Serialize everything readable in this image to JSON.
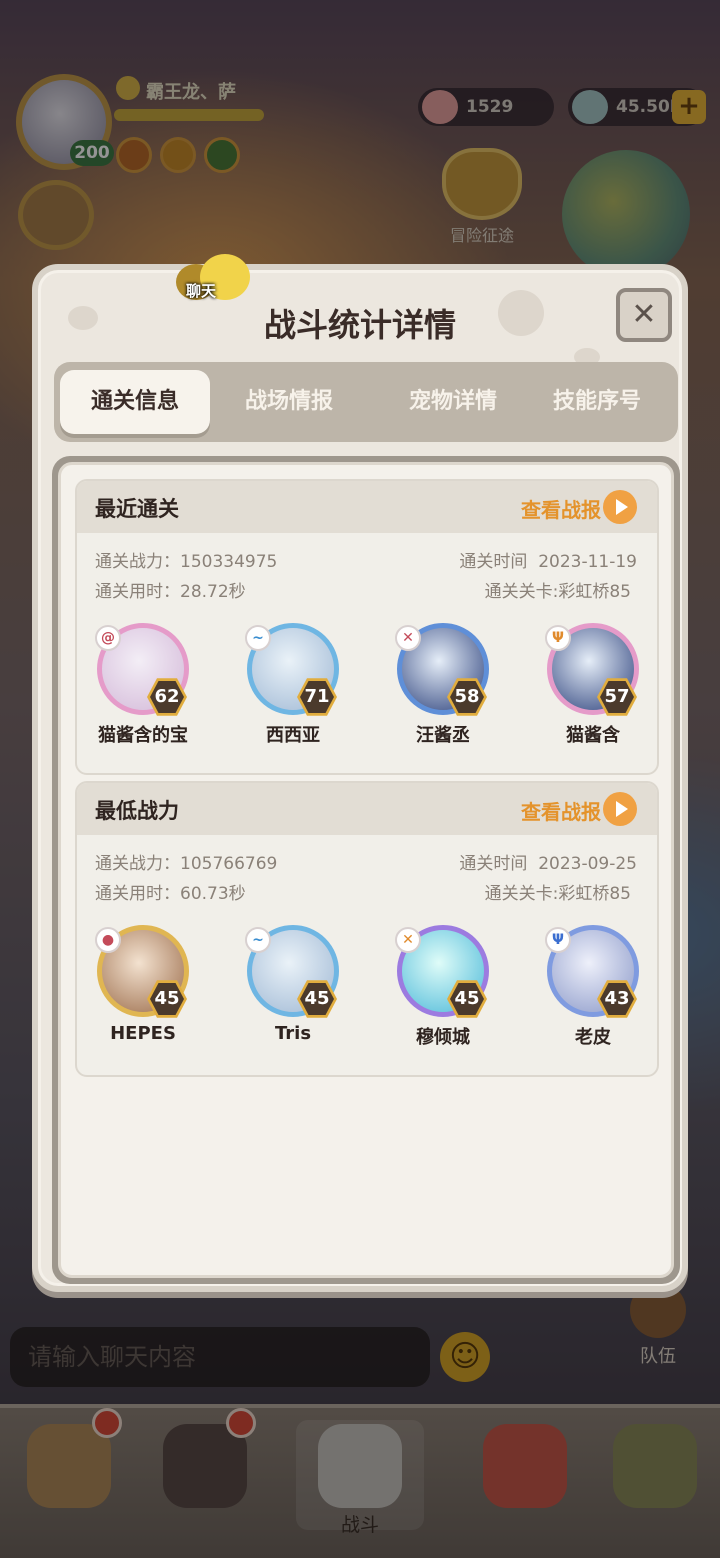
{
  "hud": {
    "player_name": "霸王龙、萨",
    "player_level": "200",
    "currency_shells": "1529",
    "currency_coins": "45.50M",
    "plus_label": "+",
    "adventure_label": "冒险征途"
  },
  "modal": {
    "title": "战斗统计详情",
    "chat_label": "聊天",
    "close_label": "✕",
    "tabs": [
      {
        "label": "通关信息"
      },
      {
        "label": "战场情报"
      },
      {
        "label": "宠物详情"
      },
      {
        "label": "技能序号"
      }
    ],
    "sections": [
      {
        "title": "最近通关",
        "report_label": "查看战报",
        "power_label": "通关战力：",
        "power_value": "150334975",
        "time_used_label": "通关用时：",
        "time_used_value": "28.72秒",
        "date_label": "通关时间",
        "date_value": "2023-11-19",
        "stage_label": "通关关卡:",
        "stage_value": "彩虹桥85",
        "pets": [
          {
            "name": "猫酱含的宝",
            "level": "62",
            "type_icon": "spiral",
            "color": "#e59bc9"
          },
          {
            "name": "西西亚",
            "level": "71",
            "type_icon": "wave",
            "color": "#6fb6e3"
          },
          {
            "name": "汪酱丞",
            "level": "58",
            "type_icon": "fire",
            "color": "#5f8fd8"
          },
          {
            "name": "猫酱含",
            "level": "57",
            "type_icon": "trident",
            "color": "#e59bc9"
          }
        ]
      },
      {
        "title": "最低战力",
        "report_label": "查看战报",
        "power_label": "通关战力：",
        "power_value": "105766769",
        "time_used_label": "通关用时：",
        "time_used_value": "60.73秒",
        "date_label": "通关时间",
        "date_value": "2023-09-25",
        "stage_label": "通关关卡:",
        "stage_value": "彩虹桥85",
        "pets": [
          {
            "name": "HEPES",
            "level": "45",
            "type_icon": "fire",
            "color": "#e0b652"
          },
          {
            "name": "Tris",
            "level": "45",
            "type_icon": "wave",
            "color": "#6fb6e3"
          },
          {
            "name": "穆倾城",
            "level": "45",
            "type_icon": "fire",
            "color": "#9c7be0"
          },
          {
            "name": "老皮",
            "level": "43",
            "type_icon": "trident",
            "color": "#7f9be0"
          }
        ]
      }
    ]
  },
  "chat": {
    "placeholder": "请输入聊天内容",
    "emoji": "☺"
  },
  "team_label": "队伍",
  "bottom_nav": [
    {
      "label": ""
    },
    {
      "label": ""
    },
    {
      "label": "战斗"
    },
    {
      "label": ""
    },
    {
      "label": ""
    }
  ]
}
